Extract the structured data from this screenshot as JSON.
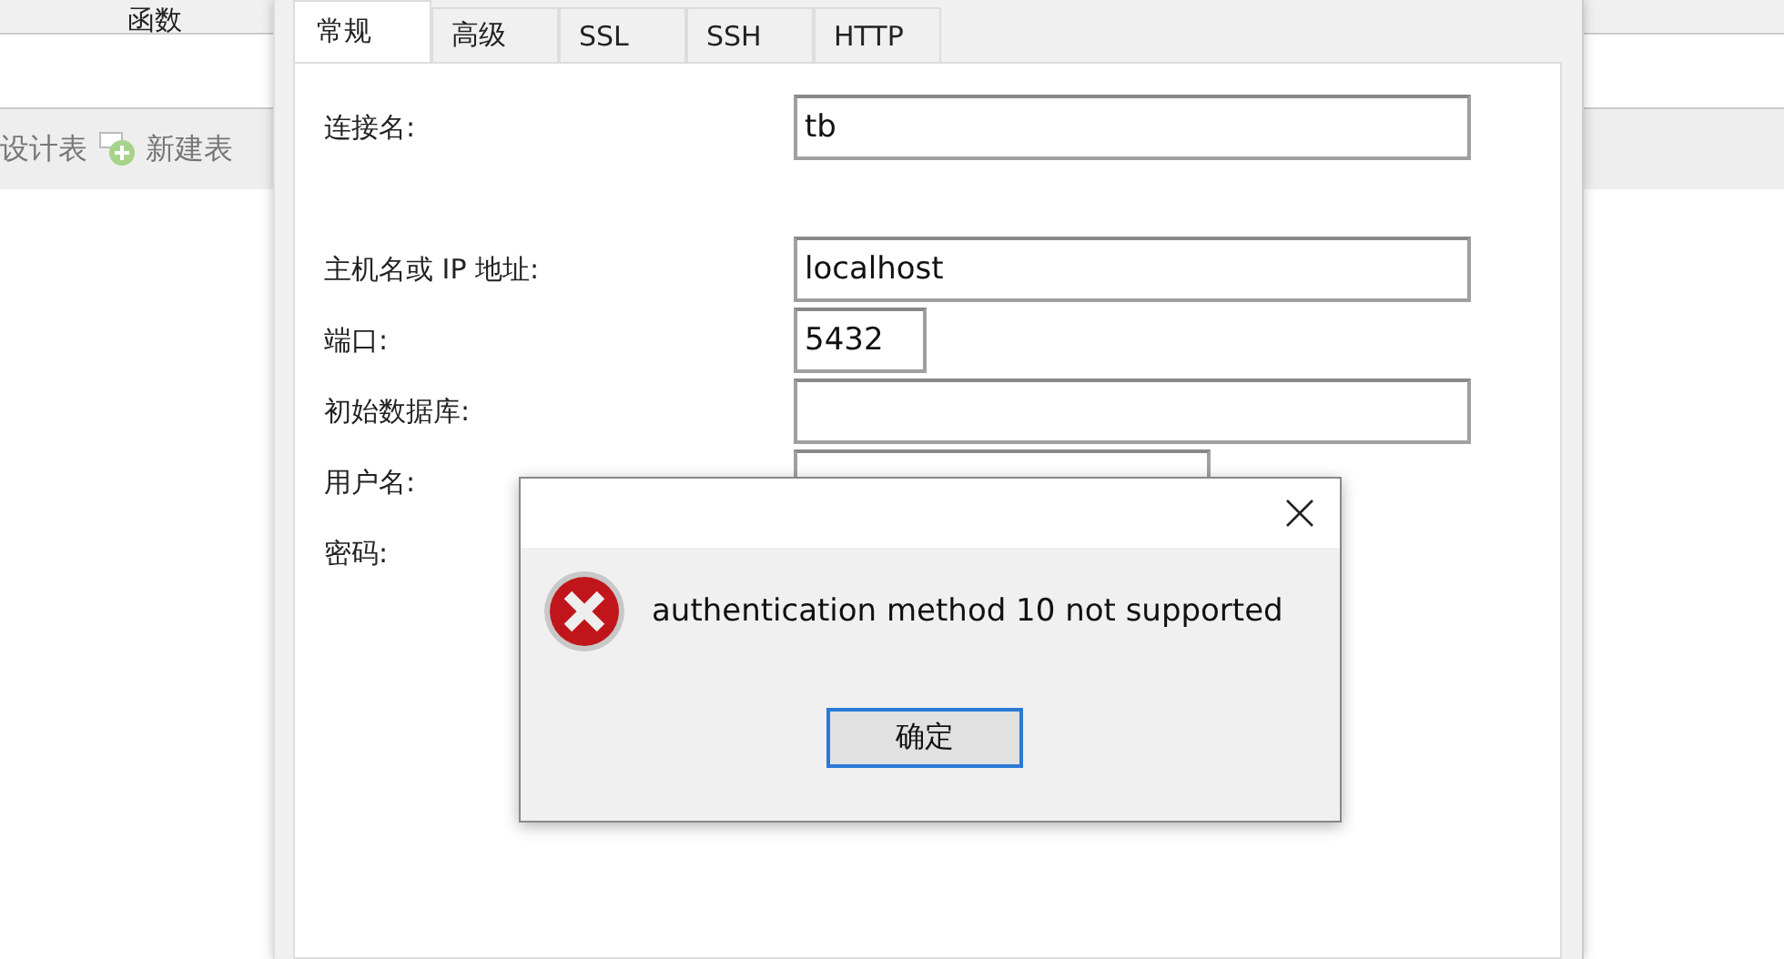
{
  "background_app": {
    "tab": "函数",
    "toolbar": [
      "设计表",
      "新建表"
    ]
  },
  "connection_dialog": {
    "tabs": [
      {
        "label": "常规",
        "selected": true
      },
      {
        "label": "高级",
        "selected": false
      },
      {
        "label": "SSL",
        "selected": false
      },
      {
        "label": "SSH",
        "selected": false
      },
      {
        "label": "HTTP",
        "selected": false
      }
    ],
    "fields": [
      {
        "label": "连接名:",
        "value": "tb",
        "kind": "wide"
      },
      {
        "label": "主机名或 IP 地址:",
        "value": "localhost",
        "kind": "wide"
      },
      {
        "label": "端口:",
        "value": "5432",
        "kind": "short"
      },
      {
        "label": "初始数据库:",
        "kind": "wide"
      },
      {
        "label": "用户名:",
        "kind": "medium"
      },
      {
        "label": "密码:",
        "kind": "hidden"
      }
    ]
  },
  "error_dialog": {
    "message": "authentication method 10 not supported",
    "button": "确定"
  }
}
